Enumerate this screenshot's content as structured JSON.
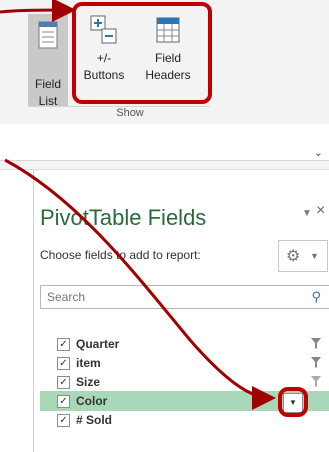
{
  "ribbon": {
    "field_list": {
      "line1": "Field",
      "line2": "List"
    },
    "plus_minus": {
      "line1": "+/-",
      "line2": "Buttons"
    },
    "field_headers": {
      "line1": "Field",
      "line2": "Headers"
    },
    "group_label": "Show"
  },
  "pane": {
    "title": "PivotTable Fields",
    "choose_label": "Choose fields to add to report:",
    "search_placeholder": "Search",
    "fields": [
      {
        "name": "Quarter",
        "checked": true,
        "filtered": true
      },
      {
        "name": "item",
        "checked": true,
        "filtered": true
      },
      {
        "name": "Size",
        "checked": true,
        "filtered": true
      },
      {
        "name": "Color",
        "checked": true,
        "highlighted": true
      },
      {
        "name": "# Sold",
        "checked": true
      }
    ]
  },
  "colors": {
    "annotation_red": "#c00000",
    "title_green": "#2b6a3a",
    "highlight_green": "#a9d8b8"
  },
  "icons": [
    "field-list-icon",
    "plus-minus-icon",
    "field-headers-icon",
    "gear-icon",
    "search-icon",
    "filter-icon",
    "dropdown-arrow-icon"
  ]
}
